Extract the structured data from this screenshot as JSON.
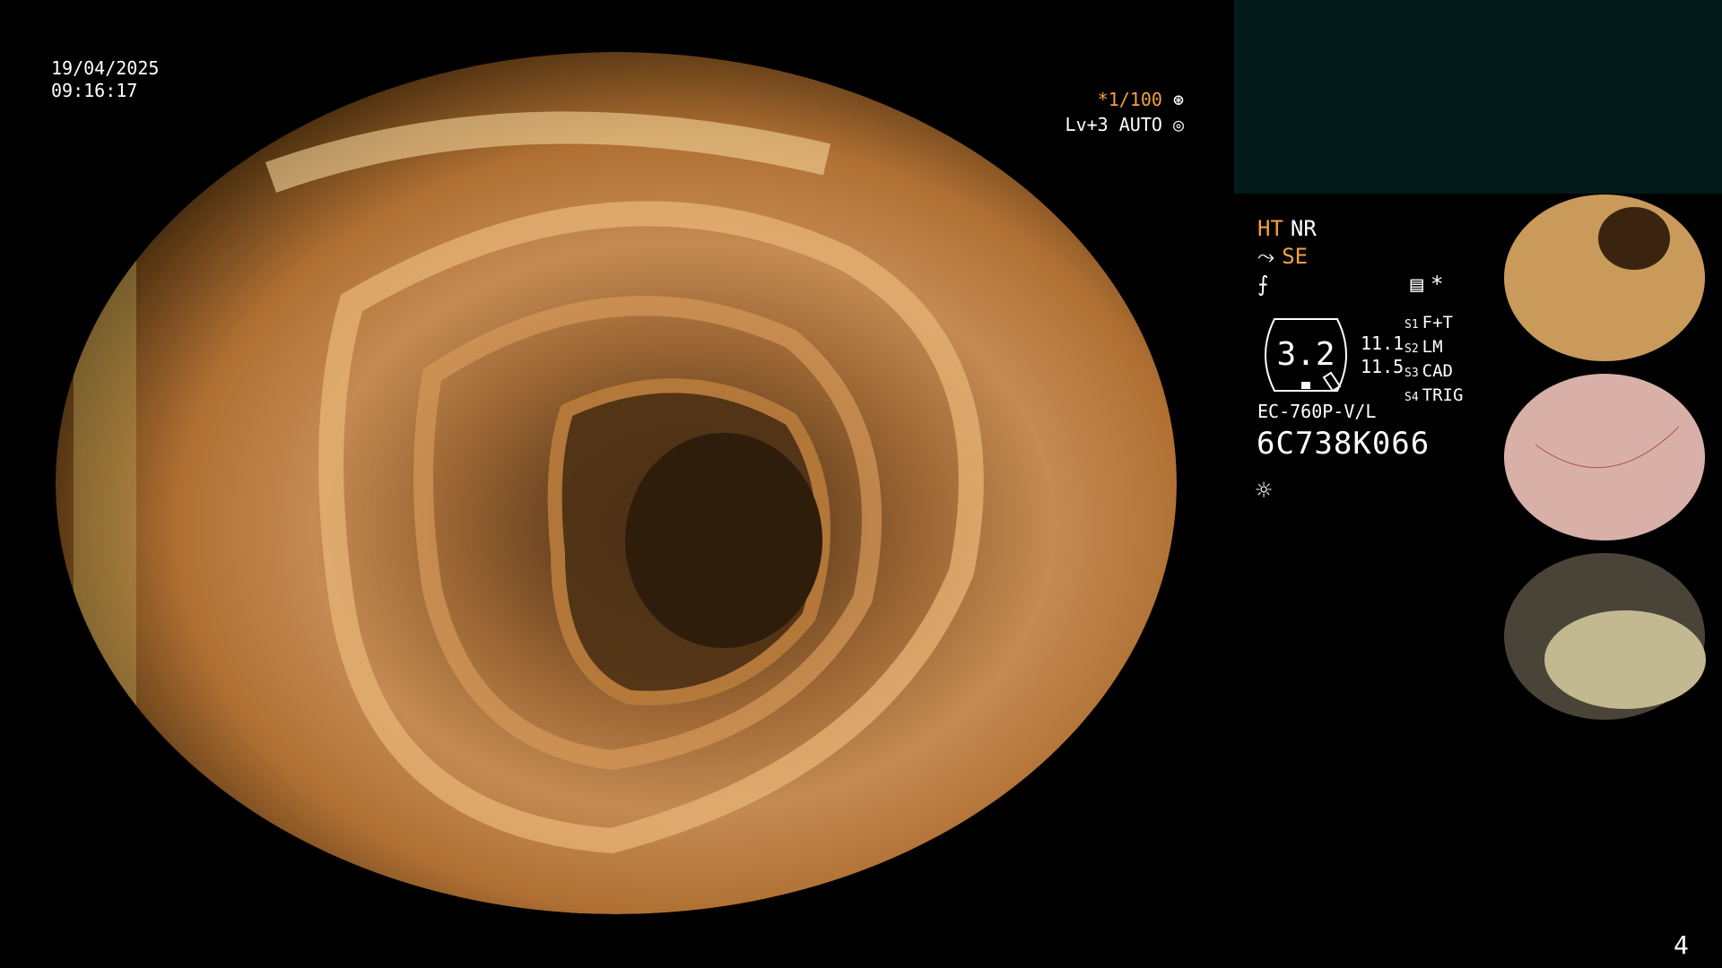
{
  "timestamp": {
    "date": "19/04/2025",
    "time": "09:16:17"
  },
  "shutter": {
    "exposure": "*1/100",
    "level": "Lv+3 AUTO"
  },
  "status": {
    "ht": "HT",
    "nr": "NR",
    "se": "SE",
    "icons": [
      "scope-icon",
      "freeze-icon",
      "record-icon",
      "asterisk-icon",
      "brightness-icon"
    ]
  },
  "scope": {
    "value": "3.2",
    "sub1": "11.1",
    "sub2": "11.5",
    "settings": [
      {
        "key": "S1",
        "value": "F+T"
      },
      {
        "key": "S2",
        "value": "LM"
      },
      {
        "key": "S3",
        "value": "CAD"
      },
      {
        "key": "S4",
        "value": "TRIG"
      }
    ],
    "model": "EC-760P-V/L",
    "serial": "6C738K066"
  },
  "page": {
    "number": "4"
  },
  "colors": {
    "amber": "#f2a23c",
    "panel": "#041a1a"
  }
}
